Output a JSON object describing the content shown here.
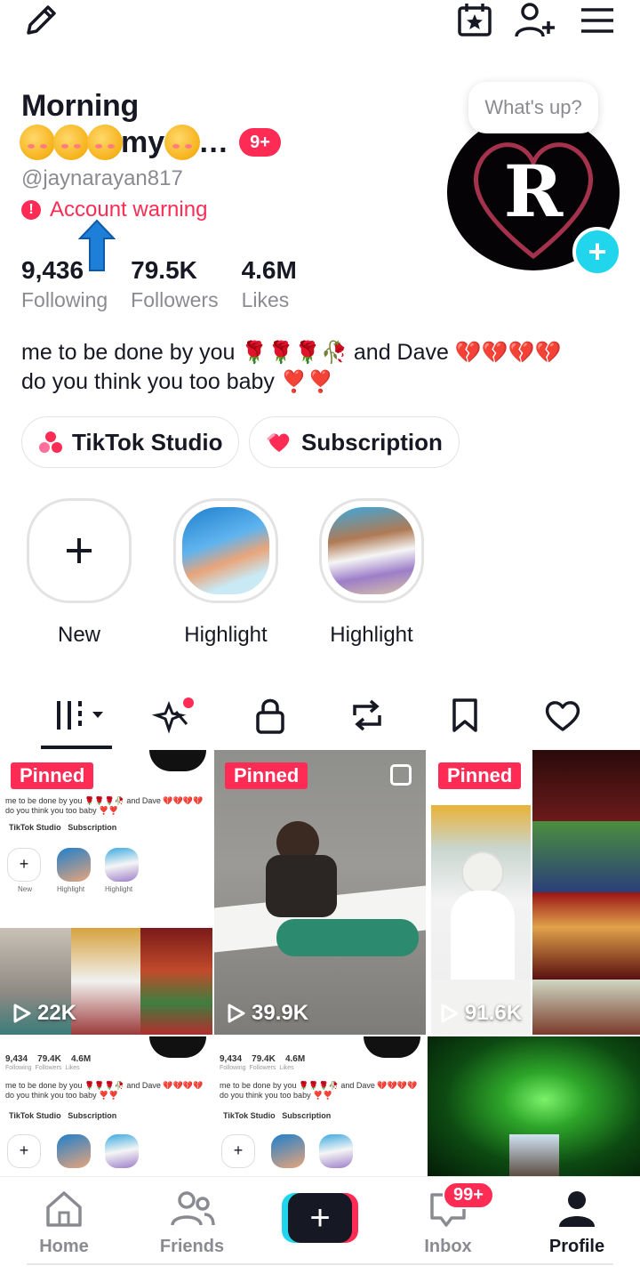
{
  "profile": {
    "name_line1": "Morning",
    "name_line2_text": "my",
    "name_line2_suffix": "…",
    "notification_count": "9+",
    "handle": "@jaynarayan817",
    "account_warning": "Account warning",
    "avatar_letter": "R",
    "status_bubble": "What's up?"
  },
  "stats": [
    {
      "value": "9,436",
      "label": "Following"
    },
    {
      "value": "79.5K",
      "label": "Followers"
    },
    {
      "value": "4.6M",
      "label": "Likes"
    }
  ],
  "bio": {
    "line1_a": "me to be done by you",
    "line1_b": "and Dave",
    "line2": "do you think you too baby"
  },
  "actions": {
    "studio": "TikTok Studio",
    "subscription": "Subscription"
  },
  "highlights": [
    {
      "label": "New"
    },
    {
      "label": "Highlight"
    },
    {
      "label": "Highlight"
    }
  ],
  "videos": [
    {
      "pinned": "Pinned",
      "views": "22K"
    },
    {
      "pinned": "Pinned",
      "views": "39.9K"
    },
    {
      "pinned": "Pinned",
      "views": "91.6K"
    }
  ],
  "mini_preview": {
    "stat1": "9,434",
    "stat1_label": "Following",
    "stat2": "79.4K",
    "stat2_label": "Followers",
    "stat3": "4.6M",
    "stat3_label": "Likes",
    "bio1": "me to be done by you 🌹🌹🌹🥀 and Dave 💔💔💔💔",
    "bio2": "do you think you too baby ❣️❣️",
    "studio": "TikTok Studio",
    "subscription": "Subscription",
    "new": "New",
    "highlight": "Highlight"
  },
  "nav": {
    "home": "Home",
    "friends": "Friends",
    "inbox": "Inbox",
    "profile": "Profile",
    "inbox_badge": "99+"
  },
  "colors": {
    "accent": "#fe2c55",
    "cyan": "#20d5ec",
    "text": "#161823",
    "muted": "#8a8b91"
  }
}
